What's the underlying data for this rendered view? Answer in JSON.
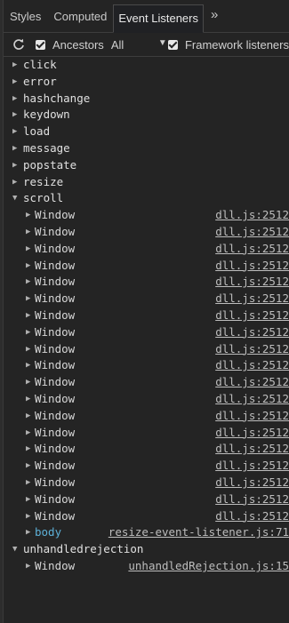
{
  "tabs": [
    "Styles",
    "Computed",
    "Event Listeners"
  ],
  "tab_more": "»",
  "toolbar": {
    "ancestors_label": "Ancestors",
    "ancestors_checked": true,
    "select_value": "All",
    "framework_label": "Framework listeners",
    "framework_checked": true
  },
  "events": [
    {
      "name": "click",
      "expanded": false
    },
    {
      "name": "error",
      "expanded": false
    },
    {
      "name": "hashchange",
      "expanded": false
    },
    {
      "name": "keydown",
      "expanded": false
    },
    {
      "name": "load",
      "expanded": false
    },
    {
      "name": "message",
      "expanded": false
    },
    {
      "name": "popstate",
      "expanded": false
    },
    {
      "name": "resize",
      "expanded": false
    },
    {
      "name": "scroll",
      "expanded": true,
      "listeners": [
        {
          "node": "Window",
          "source": "dll.js:2512"
        },
        {
          "node": "Window",
          "source": "dll.js:2512"
        },
        {
          "node": "Window",
          "source": "dll.js:2512"
        },
        {
          "node": "Window",
          "source": "dll.js:2512"
        },
        {
          "node": "Window",
          "source": "dll.js:2512"
        },
        {
          "node": "Window",
          "source": "dll.js:2512"
        },
        {
          "node": "Window",
          "source": "dll.js:2512"
        },
        {
          "node": "Window",
          "source": "dll.js:2512"
        },
        {
          "node": "Window",
          "source": "dll.js:2512"
        },
        {
          "node": "Window",
          "source": "dll.js:2512"
        },
        {
          "node": "Window",
          "source": "dll.js:2512"
        },
        {
          "node": "Window",
          "source": "dll.js:2512"
        },
        {
          "node": "Window",
          "source": "dll.js:2512"
        },
        {
          "node": "Window",
          "source": "dll.js:2512"
        },
        {
          "node": "Window",
          "source": "dll.js:2512"
        },
        {
          "node": "Window",
          "source": "dll.js:2512"
        },
        {
          "node": "Window",
          "source": "dll.js:2512"
        },
        {
          "node": "Window",
          "source": "dll.js:2512"
        },
        {
          "node": "Window",
          "source": "dll.js:2512"
        },
        {
          "node": "body",
          "source": "resize-event-listener.js:71"
        }
      ]
    },
    {
      "name": "unhandledrejection",
      "expanded": true,
      "listeners": [
        {
          "node": "Window",
          "source": "unhandledRejection.js:15"
        }
      ]
    }
  ],
  "colors": {
    "background": "#242424",
    "node_link": "#5db0d7"
  }
}
